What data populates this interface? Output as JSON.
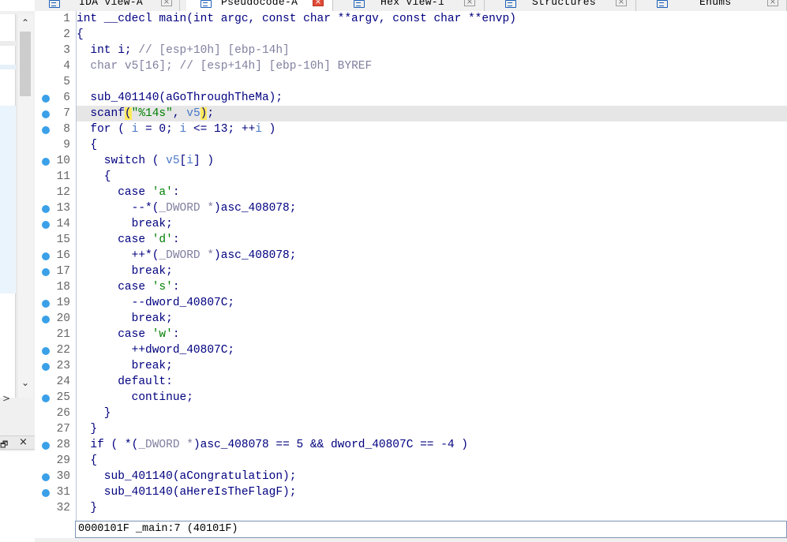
{
  "tabs": [
    {
      "label": "IDA View-A",
      "icon": "ida-view-icon",
      "active": false
    },
    {
      "label": "Pseudocode-A",
      "icon": "pseudocode-icon",
      "active": true
    },
    {
      "label": "Hex View-1",
      "icon": "hex-view-icon",
      "active": false
    },
    {
      "label": "Structures",
      "icon": "structures-icon",
      "active": false
    },
    {
      "label": "Enums",
      "icon": "enums-icon",
      "active": false
    }
  ],
  "left_panel": {
    "scroll_up_glyph": "⌃",
    "scroll_down_glyph": "⌄",
    "expand_glyph": ">",
    "pin_glyph": "🗗",
    "close_glyph": "×"
  },
  "line_numbers": [
    "1",
    "2",
    "3",
    "4",
    "5",
    "6",
    "7",
    "8",
    "9",
    "10",
    "11",
    "12",
    "13",
    "14",
    "15",
    "16",
    "17",
    "18",
    "19",
    "20",
    "21",
    "22",
    "23",
    "24",
    "25",
    "26",
    "27",
    "28",
    "29",
    "30",
    "31",
    "32"
  ],
  "breakpoint_lines": [
    6,
    7,
    8,
    10,
    13,
    14,
    16,
    17,
    19,
    20,
    22,
    23,
    25,
    28,
    30,
    31
  ],
  "highlighted_line": 7,
  "code": {
    "l1": "int __cdecl main(int argc, const char **argv, const char **envp)",
    "l2": "{",
    "l3a": "  int i; ",
    "l3b": "// [esp+10h] [ebp-14h]",
    "l4a": "  char v5[16]; ",
    "l4b": "// [esp+14h] [ebp-10h] BYREF",
    "l6": "  sub_401140(aGoThroughTheMa);",
    "l7a": "  scanf",
    "l7b": "(",
    "l7c": "\"%14s\"",
    "l7d": ", ",
    "l7e": "v5",
    "l7f": ")",
    "l7g": ";",
    "l8a": "  for ( ",
    "l8b": "i",
    "l8c": " = 0; ",
    "l8d": "i",
    "l8e": " <= 13; ++",
    "l8f": "i",
    "l8g": " )",
    "l9": "  {",
    "l10a": "    switch ( ",
    "l10b": "v5",
    "l10c": "[",
    "l10d": "i",
    "l10e": "] )",
    "l11": "    {",
    "l12a": "      case ",
    "l12b": "'a'",
    "l12c": ":",
    "l13a": "        --*(",
    "l13b": "_DWORD *",
    "l13c": ")asc_408078;",
    "l14": "        break;",
    "l15a": "      case ",
    "l15b": "'d'",
    "l15c": ":",
    "l16a": "        ++*(",
    "l16b": "_DWORD *",
    "l16c": ")asc_408078;",
    "l17": "        break;",
    "l18a": "      case ",
    "l18b": "'s'",
    "l18c": ":",
    "l19": "        --dword_40807C;",
    "l20": "        break;",
    "l21a": "      case ",
    "l21b": "'w'",
    "l21c": ":",
    "l22": "        ++dword_40807C;",
    "l23": "        break;",
    "l24": "      default:",
    "l25": "        continue;",
    "l26": "    }",
    "l27": "  }",
    "l28a": "  if ( *(",
    "l28b": "_DWORD *",
    "l28c": ")asc_408078 == 5 && dword_40807C == -4 )",
    "l29": "  {",
    "l30": "    sub_401140(aCongratulation);",
    "l31": "    sub_401140(aHereIsTheFlagF);",
    "l32": "  }"
  },
  "status_line": "0000101F _main:7 (40101F)",
  "colors": {
    "keyword": "#000080",
    "comment": "#8080a0",
    "string": "#008000",
    "variable": "#4a78c8",
    "breakpoint": "#3aa0e8",
    "paren_match": "#ffeb5a",
    "line_highlight": "#e6e6e6"
  }
}
